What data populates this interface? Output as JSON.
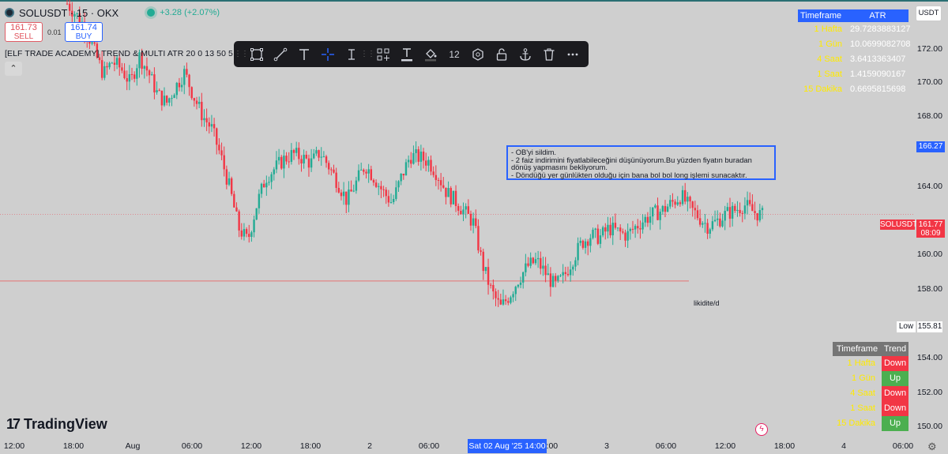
{
  "header": {
    "symbol_title": "SOLUSDT · 15 · OKX",
    "change": "+3.28 (+2.07%)",
    "sell_price": "161.73",
    "sell_label": "SELL",
    "spread": "0.01",
    "buy_price": "161.74",
    "buy_label": "BUY"
  },
  "indicator_label": "[ELF TRADE ACADEMY] TREND & MULTI ATR 20 0 13 50 5 8 11 1W",
  "toolbar": {
    "icons": [
      "rectangle-icon",
      "trendline-icon",
      "text-icon",
      "crosshair-icon",
      "cursor-text-icon",
      "add-shapes-icon",
      "text-color-icon",
      "fill-color-icon",
      "font-size",
      "hexagon-icon",
      "unlock-icon",
      "anchor-icon",
      "trash-icon",
      "more-icon"
    ],
    "font_size": "12"
  },
  "note": {
    "text": "- OB'yi sildim.\n- 2 faiz indirimini fiyatlabileceğini düşünüyorum.Bu yüzden fiyatın buradan dönüş yapmasını bekliyorum.\n- Döndüğü yer günlükten olduğu için bana bol bol long işlemi sunacaktır."
  },
  "price_axis": {
    "currency_button": "USDT",
    "labels": [
      "172.00",
      "170.00",
      "168.00",
      "164.00",
      "160.00",
      "158.00",
      "154.00",
      "152.00",
      "150.00"
    ],
    "crosshair_price": "166.27",
    "current_symbol": "SOLUSDT",
    "current_price": "161.77",
    "countdown": "08:09",
    "low_label": "Low",
    "low_price": "155.81"
  },
  "colors": {
    "up": "#22ab94",
    "down": "#f23645",
    "accent": "#2962ff",
    "atr_header": "#2962ff",
    "timeframe_text": "#ffea00",
    "trend_up": "#4caf50",
    "trend_down": "#f23645"
  },
  "atr_table": {
    "headers": [
      "Timeframe",
      "ATR"
    ],
    "rows": [
      {
        "timeframe": "1 Hafta",
        "value": "29.7283883127"
      },
      {
        "timeframe": "1 Gün",
        "value": "10.0699082708"
      },
      {
        "timeframe": "4 Saat",
        "value": "3.6413363407"
      },
      {
        "timeframe": "1 Saat",
        "value": "1.4159090167"
      },
      {
        "timeframe": "15 Dakika",
        "value": "0.6695815698"
      }
    ]
  },
  "trend_table": {
    "headers": [
      "Timeframe",
      "Trend"
    ],
    "rows": [
      {
        "timeframe": "1 Hafta",
        "trend": "Down"
      },
      {
        "timeframe": "1 Gün",
        "trend": "Up"
      },
      {
        "timeframe": "4 Saat",
        "trend": "Down"
      },
      {
        "timeframe": "1 Saat",
        "trend": "Down"
      },
      {
        "timeframe": "15 Dakika",
        "trend": "Up"
      }
    ]
  },
  "liquidity_label": "likidite/d",
  "time_axis": {
    "labels": [
      "12:00",
      "18:00",
      "Aug",
      "06:00",
      "12:00",
      "18:00",
      "2",
      "06:00",
      "18:00",
      "3",
      "06:00",
      "12:00",
      "18:00",
      "4",
      "06:00"
    ],
    "selected": "Sat 02 Aug '25   14:00"
  },
  "brand": "TradingView",
  "chart_data": {
    "type": "candlestick",
    "ylim": [
      149.4,
      173.6
    ],
    "liquidity_level": 158.08,
    "current_price": 161.77,
    "series": [
      {
        "name": "SOLUSDT",
        "close_path": [
          173.4,
          172.8,
          172.1,
          170.8,
          169.5,
          170.2,
          169.8,
          169.0,
          170.5,
          169.6,
          168.4,
          167.9,
          168.8,
          169.6,
          168.3,
          167.2,
          166.5,
          165.0,
          163.2,
          161.0,
          160.3,
          162.3,
          163.8,
          164.3,
          164.8,
          165.1,
          164.9,
          164.6,
          165.2,
          164.4,
          163.5,
          162.5,
          163.5,
          164.5,
          163.8,
          163.0,
          162.4,
          163.8,
          165.0,
          164.9,
          164.7,
          164.0,
          163.0,
          162.5,
          161.9,
          161.3,
          159.0,
          157.5,
          156.6,
          157.3,
          158.2,
          158.9,
          159.2,
          158.5,
          157.8,
          158.3,
          159.3,
          160.2,
          160.6,
          160.5,
          161.0,
          160.8,
          160.6,
          161.1,
          161.5,
          161.8,
          162.0,
          162.4,
          162.8,
          162.1,
          161.6,
          161.1,
          161.4,
          161.8,
          162.0,
          162.3,
          161.9,
          161.7
        ]
      }
    ]
  }
}
